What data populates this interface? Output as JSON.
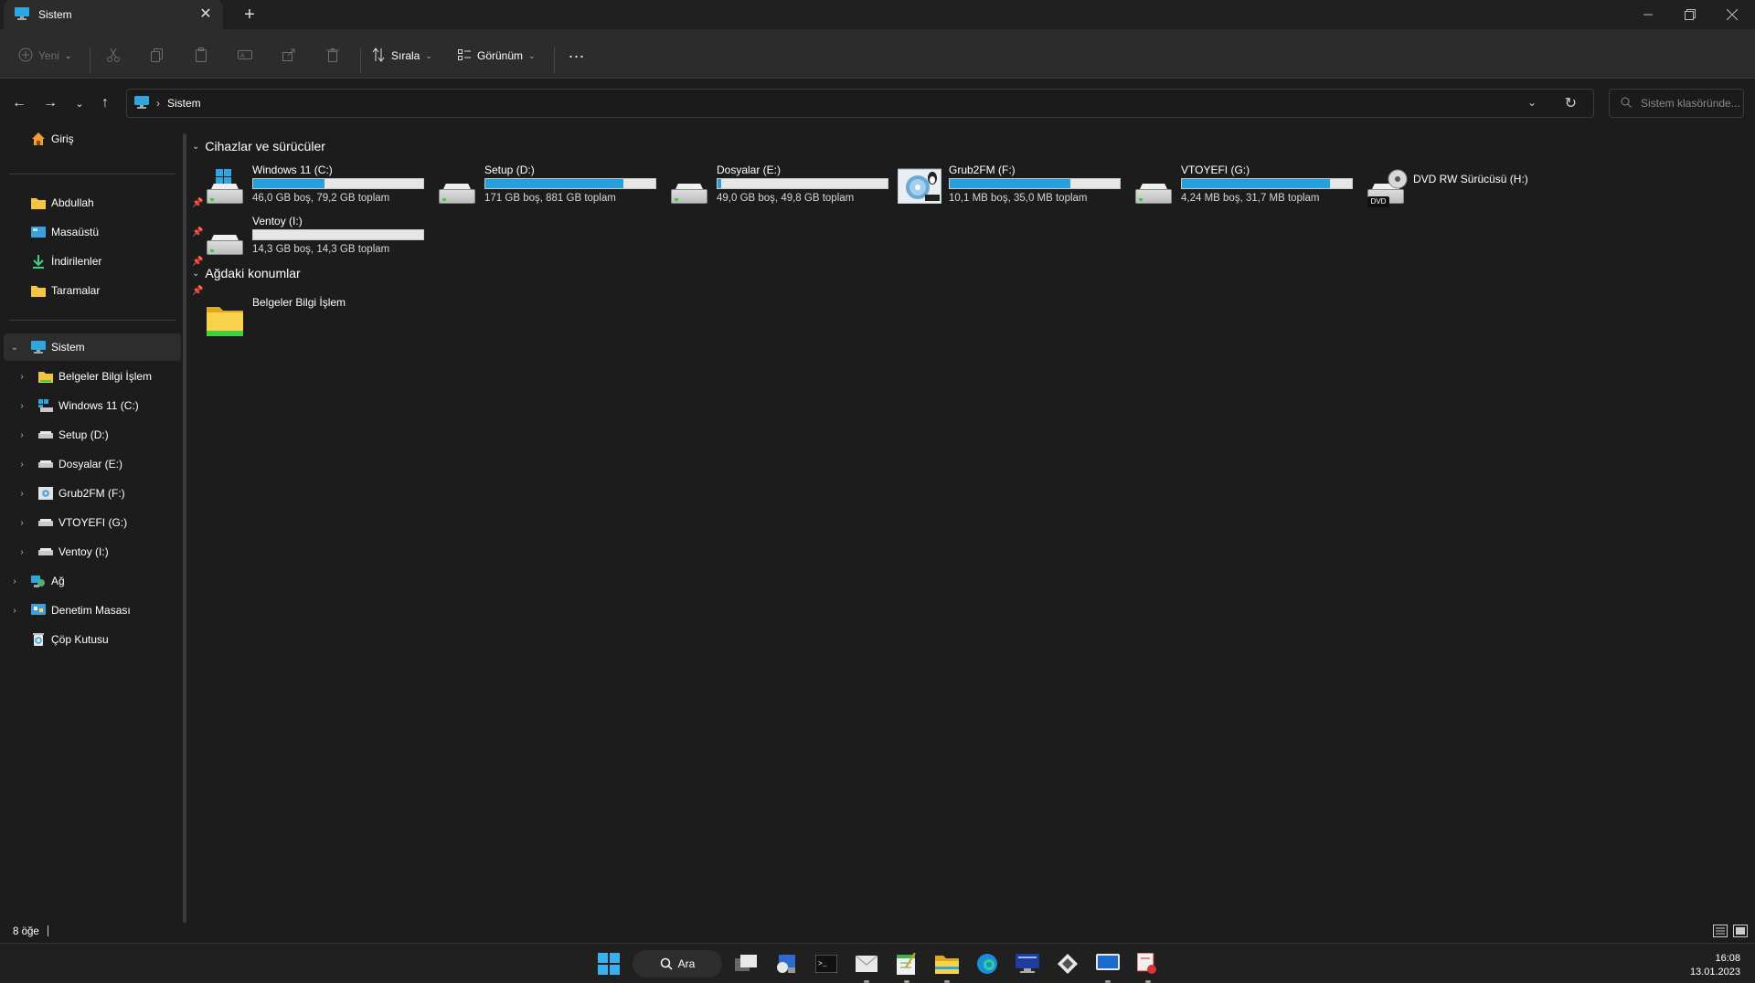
{
  "window": {
    "tab_title": "Sistem",
    "tab_icon": "computer-icon"
  },
  "toolbar": {
    "new_label": "Yeni",
    "sort_label": "Sırala",
    "view_label": "Görünüm",
    "more_label": "..."
  },
  "address": {
    "crumb": "Sistem",
    "search_placeholder": "Sistem klasöründe..."
  },
  "sidebar": {
    "home": "Giriş",
    "pinned": [
      {
        "label": "Abdullah",
        "icon": "folder-icon"
      },
      {
        "label": "Masaüstü",
        "icon": "desktop-icon"
      },
      {
        "label": "İndirilenler",
        "icon": "download-icon"
      },
      {
        "label": "Taramalar",
        "icon": "folder-icon"
      }
    ],
    "system": "Sistem",
    "system_children": [
      {
        "label": "Belgeler Bilgi İşlem",
        "icon": "network-folder-icon"
      },
      {
        "label": "Windows 11 (C:)",
        "icon": "windows-drive-icon"
      },
      {
        "label": "Setup (D:)",
        "icon": "drive-icon"
      },
      {
        "label": "Dosyalar (E:)",
        "icon": "drive-icon"
      },
      {
        "label": "Grub2FM (F:)",
        "icon": "grub-drive-icon"
      },
      {
        "label": "VTOYEFI (G:)",
        "icon": "drive-icon"
      },
      {
        "label": "Ventoy (I:)",
        "icon": "drive-icon"
      }
    ],
    "network": "Ağ",
    "control_panel": "Denetim Masası",
    "recycle_bin": "Çöp Kutusu"
  },
  "content": {
    "devices_header": "Cihazlar ve sürücüler",
    "network_header": "Ağdaki konumlar",
    "drives": [
      {
        "name": "Windows 11 (C:)",
        "info": "46,0 GB boş, 79,2 GB toplam",
        "used_fraction": 0.42,
        "kind": "windows"
      },
      {
        "name": "Setup (D:)",
        "info": "171 GB boş, 881 GB toplam",
        "used_fraction": 0.81,
        "kind": "hdd"
      },
      {
        "name": "Dosyalar (E:)",
        "info": "49,0 GB boş, 49,8 GB toplam",
        "used_fraction": 0.02,
        "kind": "hdd"
      },
      {
        "name": "Grub2FM (F:)",
        "info": "10,1 MB boş, 35,0 MB toplam",
        "used_fraction": 0.71,
        "kind": "grub"
      },
      {
        "name": "VTOYEFI (G:)",
        "info": "4,24 MB boş, 31,7 MB toplam",
        "used_fraction": 0.87,
        "kind": "hdd"
      },
      {
        "name": "DVD RW Sürücüsü (H:)",
        "info": "",
        "used_fraction": null,
        "kind": "dvd"
      },
      {
        "name": "Ventoy (I:)",
        "info": "14,3 GB boş, 14,3 GB toplam",
        "used_fraction": 0.0,
        "kind": "hdd"
      }
    ],
    "dvd_label": "DVD",
    "network_locations": [
      {
        "name": "Belgeler Bilgi İşlem"
      }
    ]
  },
  "status": {
    "item_count": "8 öğe"
  },
  "taskbar": {
    "search_label": "Ara",
    "time": "16:08",
    "date": "13.01.2023"
  },
  "colors": {
    "accent": "#26a0da",
    "background": "#1c1c1c",
    "folder": "#f5c542"
  }
}
